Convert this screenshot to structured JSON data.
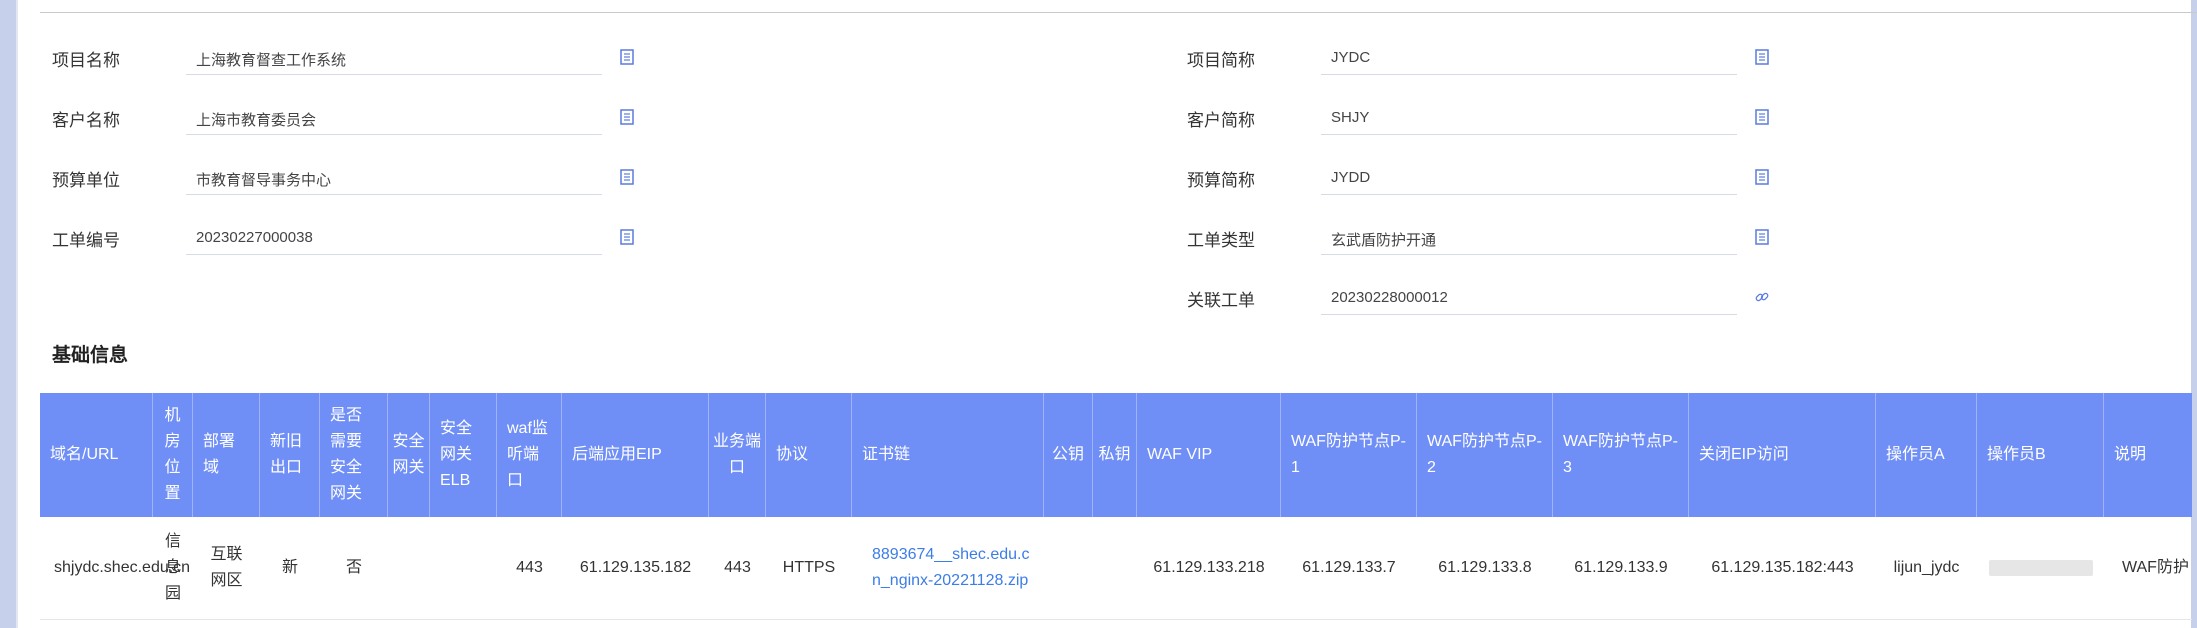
{
  "form": {
    "project_name": {
      "label": "项目名称",
      "value": "上海教育督查工作系统"
    },
    "project_short": {
      "label": "项目简称",
      "value": "JYDC"
    },
    "customer_name": {
      "label": "客户名称",
      "value": "上海市教育委员会"
    },
    "customer_short": {
      "label": "客户简称",
      "value": "SHJY"
    },
    "budget_unit": {
      "label": "预算单位",
      "value": "市教育督导事务中心"
    },
    "budget_short": {
      "label": "预算简称",
      "value": "JYDD"
    },
    "ticket_no": {
      "label": "工单编号",
      "value": "20230227000038"
    },
    "ticket_type": {
      "label": "工单类型",
      "value": "玄武盾防护开通"
    },
    "related_ticket": {
      "label": "关联工单",
      "value": "20230228000012"
    }
  },
  "section": {
    "title": "基础信息"
  },
  "table": {
    "headers": [
      "域名/URL",
      "机房位置",
      "部署域",
      "新旧出口",
      "是否需要安全网关",
      "安全网关",
      "安全网关ELB",
      "waf监听端口",
      "后端应用EIP",
      "业务端口",
      "协议",
      "证书链",
      "公钥",
      "私钥",
      "WAF VIP",
      "WAF防护节点P-1",
      "WAF防护节点P-2",
      "WAF防护节点P-3",
      "关闭EIP访问",
      "操作员A",
      "操作员B",
      "说明"
    ],
    "row": {
      "domain": "shjydc.shec.edu.cn",
      "room": "信息园",
      "zone": "互联网区",
      "exit": "新",
      "need_gateway": "否",
      "gateway": "",
      "gateway_elb": "",
      "waf_port": "443",
      "backend_eip": "61.129.135.182",
      "biz_port": "443",
      "protocol": "HTTPS",
      "cert": "8893674__shec.edu.cn_nginx-20221128.zip",
      "public_key": "",
      "private_key": "",
      "waf_vip": "61.129.133.218",
      "p1": "61.129.133.7",
      "p2": "61.129.133.8",
      "p3": "61.129.133.9",
      "close_eip": "61.129.135.182:443",
      "operator_a": "lijun_jydc",
      "operator_b": "",
      "note": "WAF防护"
    }
  },
  "colors": {
    "header_bg": "#6f8ff7",
    "link": "#3c7de6",
    "icon": "#5b7be0"
  }
}
